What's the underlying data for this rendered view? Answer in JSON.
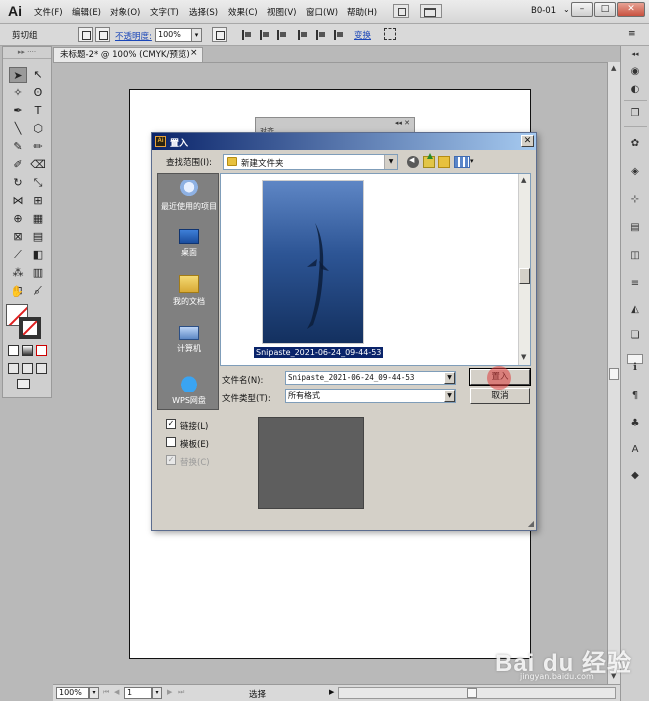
{
  "app": {
    "logo": "Ai"
  },
  "menu": {
    "items": [
      "文件(F)",
      "编辑(E)",
      "对象(O)",
      "文字(T)",
      "选择(S)",
      "效果(C)",
      "视图(V)",
      "窗口(W)",
      "帮助(H)"
    ],
    "workspace": "B0-01",
    "window_buttons": {
      "minimize": "–",
      "maximize": "□",
      "close": "✕"
    }
  },
  "control_bar": {
    "selection_type": "剪切组",
    "opacity_label": "不透明度:",
    "opacity_value": "100%",
    "transform_label": "变换"
  },
  "document": {
    "tab_title": "未标题-2* @ 100% (CMYK/预览)",
    "tab_close": "×"
  },
  "status_bar": {
    "zoom": "100%",
    "page": "1",
    "status_text": "选择"
  },
  "dialog": {
    "title": "置入",
    "close": "✕",
    "look_in_label": "查找范围(I):",
    "look_in_value": "新建文件夹",
    "places": [
      {
        "label": "最近使用的项目",
        "icon": "recent-items-icon"
      },
      {
        "label": "桌面",
        "icon": "desktop-icon"
      },
      {
        "label": "我的文档",
        "icon": "my-documents-icon"
      },
      {
        "label": "计算机",
        "icon": "computer-icon"
      },
      {
        "label": "WPS网盘",
        "icon": "wps-cloud-icon"
      }
    ],
    "file": {
      "name": "Snipaste_2021-06-24_09-44-53"
    },
    "filename_label": "文件名(N):",
    "filename_value": "Snipaste_2021-06-24_09-44-53",
    "filetype_label": "文件类型(T):",
    "filetype_value": "所有格式",
    "place_button": "置入",
    "cancel_button": "取消",
    "options": {
      "link": {
        "label": "链接(L)",
        "checked": true
      },
      "template": {
        "label": "模板(E)",
        "checked": false
      },
      "replace": {
        "label": "替换(C)",
        "checked": true,
        "disabled": true
      }
    }
  },
  "behind_panel": {
    "label": "对齐",
    "controls": "◂◂ ✕"
  },
  "watermark": {
    "brand": "Bai du 经验",
    "url": "jingyan.baidu.com"
  },
  "colors": {
    "titlebar": "#0a246a",
    "accent": "#1b47b8",
    "stroke_none": "#e02020"
  }
}
